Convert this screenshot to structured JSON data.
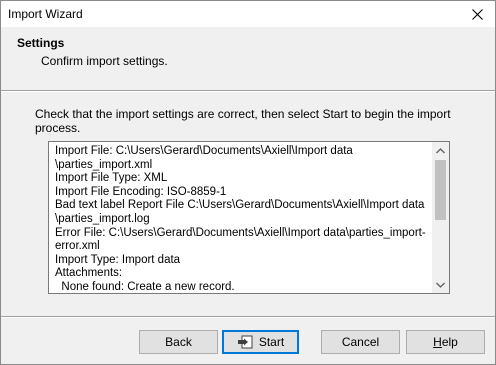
{
  "window": {
    "title": "Import Wizard"
  },
  "header": {
    "section_title": "Settings",
    "section_subtitle": "Confirm import settings."
  },
  "main": {
    "instructions": "Check that the import settings are correct, then select Start to begin the import process.",
    "summary_lines": "Import File: C:\\Users\\Gerard\\Documents\\Axiell\\Import data\n\\parties_import.xml\nImport File Type: XML\nImport File Encoding: ISO-8859-1\nBad text label Report File C:\\Users\\Gerard\\Documents\\Axiell\\Import data\n\\parties_import.log\nError File: C:\\Users\\Gerard\\Documents\\Axiell\\Import data\\parties_import-\nerror.xml\nImport Type: Import data\nAttachments:\n  None found: Create a new record.\n  One found: Use first record found."
  },
  "buttons": {
    "back": "Back",
    "start": "Start",
    "cancel": "Cancel",
    "help": "Help"
  },
  "icons": {
    "close": "close-icon",
    "start": "import-start-icon",
    "scroll_up": "scroll-up-arrow-icon",
    "scroll_down": "scroll-down-arrow-icon"
  },
  "colors": {
    "accent": "#0078d7",
    "window_bg": "#f0f0f0"
  }
}
